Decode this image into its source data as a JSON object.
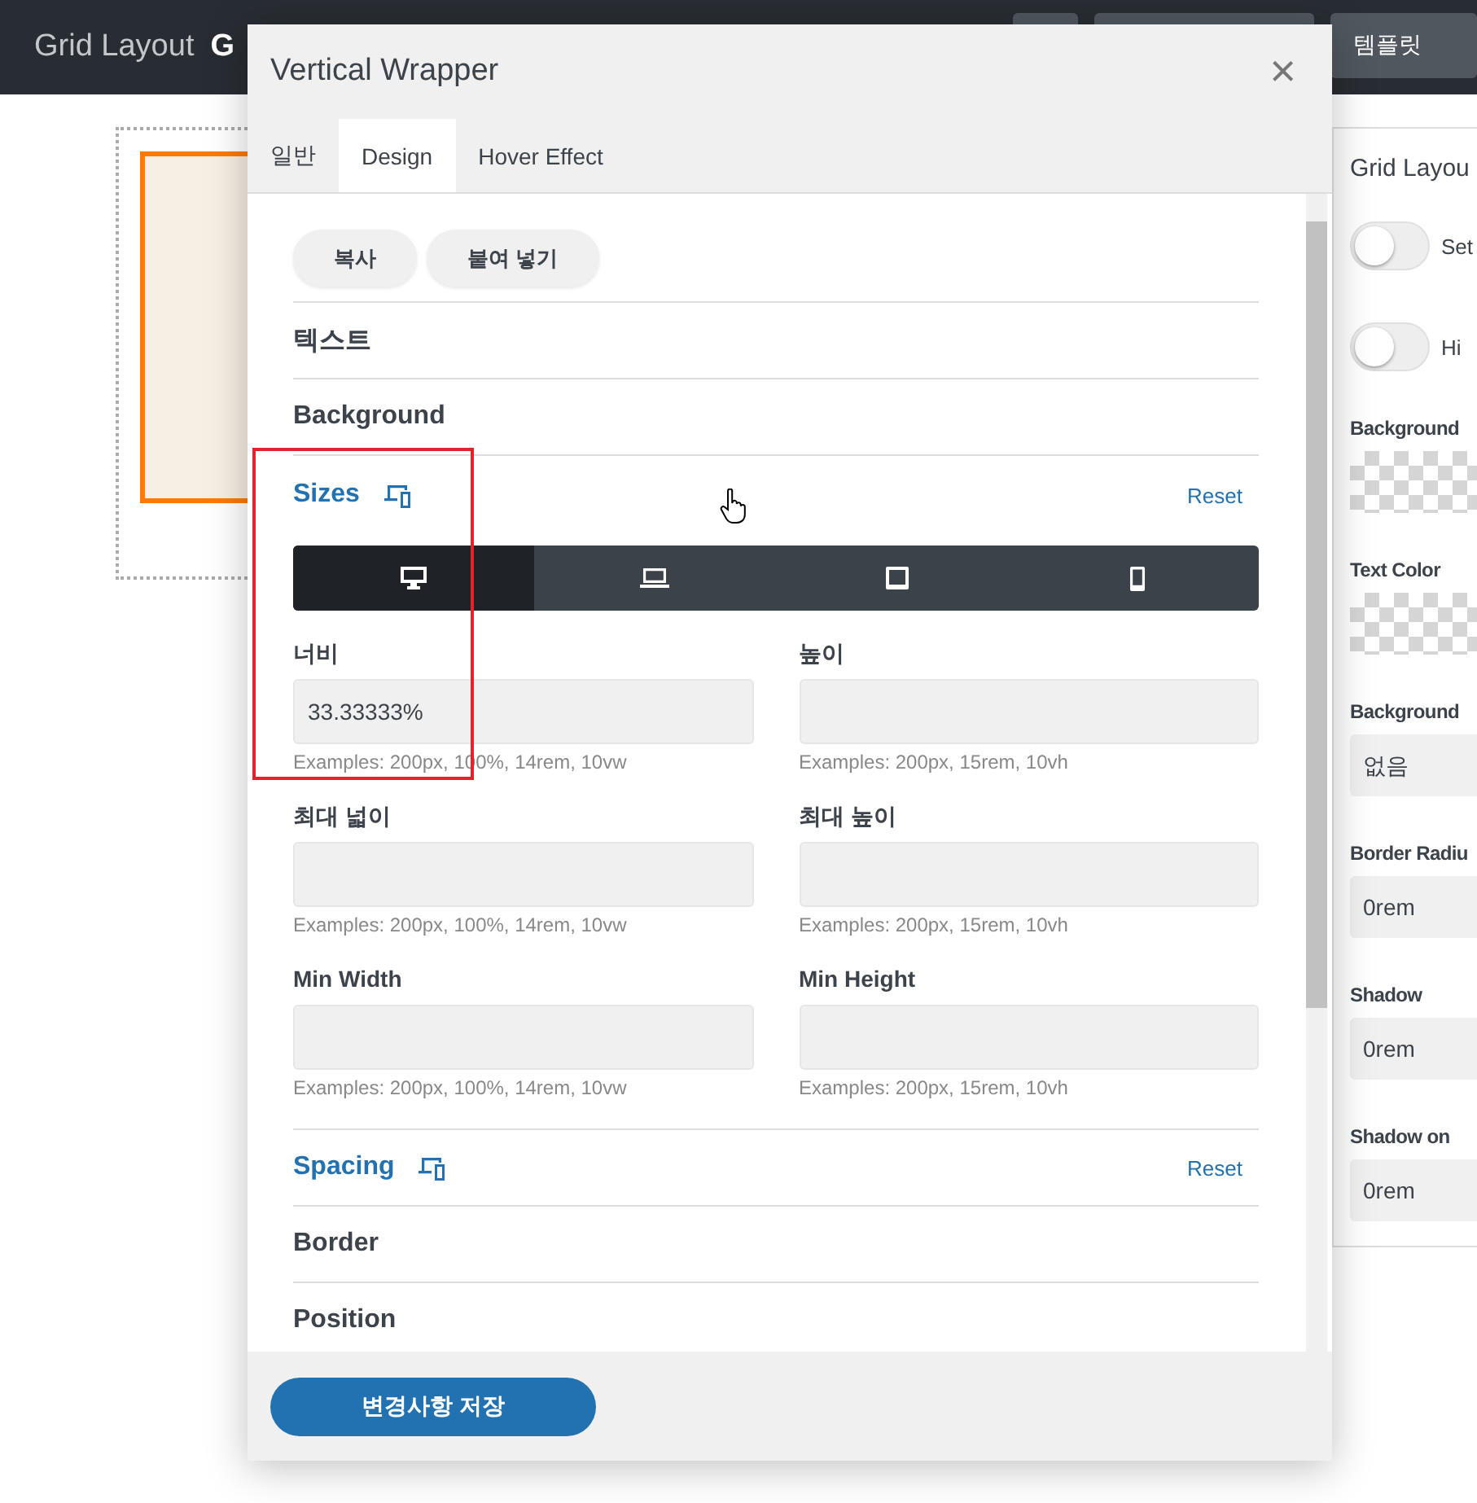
{
  "app_bar": {
    "title": "Grid Layout",
    "title_cut": "G",
    "template_button": "템플릿"
  },
  "right_panel": {
    "heading": "Grid Layou",
    "toggles": [
      {
        "label": "Set",
        "on": false
      },
      {
        "label": "Hi",
        "on": false
      }
    ],
    "fields": [
      {
        "kind": "swatch",
        "label": "Background"
      },
      {
        "kind": "swatch",
        "label": "Text Color"
      },
      {
        "kind": "select",
        "label": "Background",
        "value": "없음"
      },
      {
        "kind": "input",
        "label": "Border Radiu",
        "value": "0rem"
      },
      {
        "kind": "input",
        "label": "Shadow",
        "value": "0rem"
      },
      {
        "kind": "input",
        "label": "Shadow on",
        "value": "0rem"
      }
    ]
  },
  "dialog": {
    "title": "Vertical Wrapper",
    "close": "×",
    "tabs": [
      {
        "label": "일반",
        "selected": false
      },
      {
        "label": "Design",
        "selected": true
      },
      {
        "label": "Hover Effect",
        "selected": false
      }
    ],
    "copy_buttons": [
      "복사",
      "붙여 넣기"
    ],
    "sections_before": [
      {
        "kind": "plain",
        "title": "텍스트"
      },
      {
        "kind": "plain",
        "title": "Background"
      }
    ],
    "sizes": {
      "title": "Sizes",
      "reset": "Reset",
      "devices": [
        {
          "kind": "desktop",
          "selected": true
        },
        {
          "kind": "laptop",
          "selected": false
        },
        {
          "kind": "tablet",
          "selected": false
        },
        {
          "kind": "phone",
          "selected": false
        }
      ],
      "fields": [
        {
          "label": "너비",
          "value": "33.33333%",
          "hint": "Examples: 200px, 100%, 14rem, 10vw"
        },
        {
          "label": "높이",
          "hint": "Examples: 200px, 15rem, 10vh"
        },
        {
          "label": "최대 넓이",
          "hint": "Examples: 200px, 100%, 14rem, 10vw"
        },
        {
          "label": "최대 높이",
          "hint": "Examples: 200px, 15rem, 10vh"
        },
        {
          "label": "Min Width",
          "hint": "Examples: 200px, 100%, 14rem, 10vw"
        },
        {
          "label": "Min Height",
          "hint": "Examples: 200px, 15rem, 10vh"
        }
      ]
    },
    "sections_after": [
      {
        "kind": "responsive",
        "title": "Spacing",
        "reset": "Reset"
      },
      {
        "kind": "plain",
        "title": "Border"
      },
      {
        "kind": "plain",
        "title": "Position"
      }
    ],
    "save_button": "변경사항 저장"
  }
}
